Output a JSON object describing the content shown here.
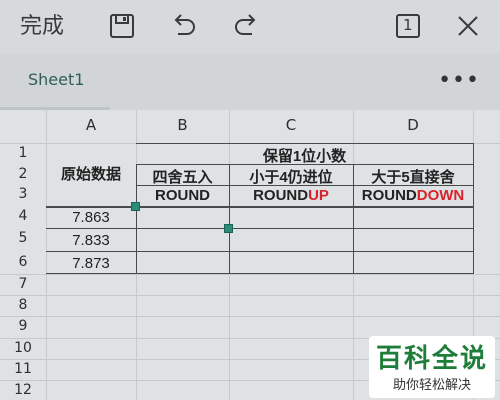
{
  "toolbar": {
    "done_label": "完成",
    "icons": [
      "save-icon",
      "undo-icon",
      "redo-icon",
      "sheet-count-icon",
      "close-icon"
    ],
    "sheet_count": "1"
  },
  "sheets": {
    "active": "Sheet1",
    "more_label": "•••"
  },
  "columns": [
    "A",
    "B",
    "C",
    "D"
  ],
  "rows": [
    "1",
    "2",
    "3",
    "4",
    "5",
    "6",
    "7",
    "8",
    "9",
    "10",
    "11",
    "12"
  ],
  "table": {
    "a_header": "原始数据",
    "group_header": "保留1位小数",
    "b_title": "四舍五入",
    "c_title": "小于4仍进位",
    "d_title": "大于5直接舍",
    "b_func": "ROUND",
    "c_func_black": "ROUND",
    "c_func_red": "UP",
    "d_func_black": "ROUND",
    "d_func_red": "DOWN",
    "values": [
      "7.863",
      "7.833",
      "7.873"
    ]
  },
  "watermark": {
    "title": "百科全说",
    "subtitle": "助你轻松解决"
  },
  "colors": {
    "accent": "#2b8c7a",
    "red_text": "#d6242a",
    "sheet_tab_text": "#2f5e59"
  }
}
